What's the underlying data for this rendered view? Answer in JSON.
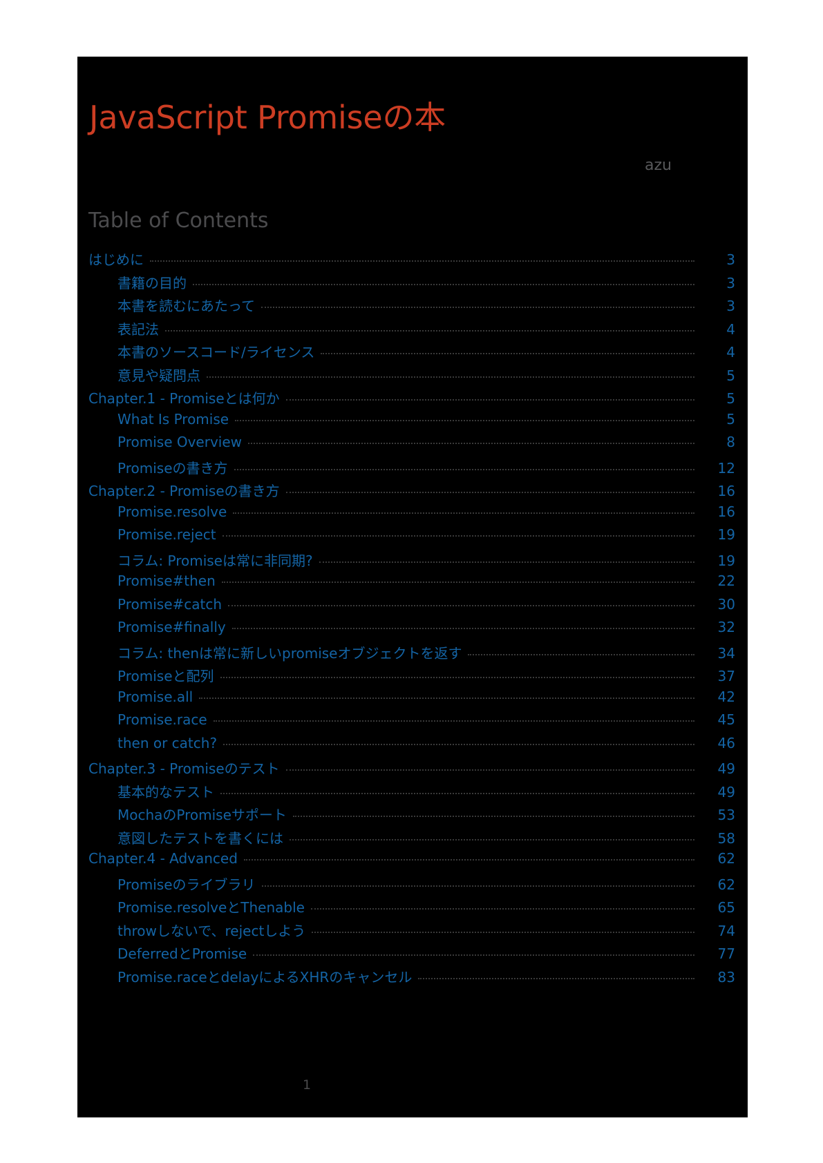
{
  "document": {
    "title": "JavaScript Promiseの本",
    "author": "azu",
    "toc_heading": "Table of Contents",
    "folio": "1",
    "colors": {
      "page_background": "#000000",
      "title": "#cc3d23",
      "heading": "#4b4b4d",
      "link": "#1464a5",
      "leader": "#3a3a3a"
    }
  },
  "toc": {
    "entries": [
      {
        "label": "はじめに",
        "page": "3",
        "level": 1
      },
      {
        "label": "書籍の目的",
        "page": "3",
        "level": 2
      },
      {
        "label": "本書を読むにあたって",
        "page": "3",
        "level": 2
      },
      {
        "label": "表記法",
        "page": "4",
        "level": 2
      },
      {
        "label": "本書のソースコード/ライセンス",
        "page": "4",
        "level": 2
      },
      {
        "label": "意見や疑問点",
        "page": "5",
        "level": 2
      },
      {
        "label": "Chapter.1 - Promiseとは何か",
        "page": "5",
        "level": 1
      },
      {
        "label": "What Is Promise",
        "page": "5",
        "level": 2
      },
      {
        "label": "Promise Overview",
        "page": "8",
        "level": 2
      },
      {
        "label": "Promiseの書き方",
        "page": "12",
        "level": 2
      },
      {
        "label": "Chapter.2 - Promiseの書き方",
        "page": "16",
        "level": 1
      },
      {
        "label": "Promise.resolve",
        "page": "16",
        "level": 2
      },
      {
        "label": "Promise.reject",
        "page": "19",
        "level": 2
      },
      {
        "label": "コラム: Promiseは常に非同期?",
        "page": "19",
        "level": 2
      },
      {
        "label": "Promise#then",
        "page": "22",
        "level": 2
      },
      {
        "label": "Promise#catch",
        "page": "30",
        "level": 2
      },
      {
        "label": "Promise#finally",
        "page": "32",
        "level": 2
      },
      {
        "label": "コラム: thenは常に新しいpromiseオブジェクトを返す",
        "page": "34",
        "level": 2
      },
      {
        "label": "Promiseと配列",
        "page": "37",
        "level": 2
      },
      {
        "label": "Promise.all",
        "page": "42",
        "level": 2
      },
      {
        "label": "Promise.race",
        "page": "45",
        "level": 2
      },
      {
        "label": "then or catch?",
        "page": "46",
        "level": 2
      },
      {
        "label": "Chapter.3 - Promiseのテスト",
        "page": "49",
        "level": 1
      },
      {
        "label": "基本的なテスト",
        "page": "49",
        "level": 2
      },
      {
        "label": "MochaのPromiseサポート",
        "page": "53",
        "level": 2
      },
      {
        "label": "意図したテストを書くには",
        "page": "58",
        "level": 2
      },
      {
        "label": "Chapter.4 - Advanced",
        "page": "62",
        "level": 1
      },
      {
        "label": "Promiseのライブラリ",
        "page": "62",
        "level": 2
      },
      {
        "label": "Promise.resolveとThenable",
        "page": "65",
        "level": 2
      },
      {
        "label": "throwしないで、rejectしよう",
        "page": "74",
        "level": 2
      },
      {
        "label": "DeferredとPromise",
        "page": "77",
        "level": 2
      },
      {
        "label": "Promise.raceとdelayによるXHRのキャンセル",
        "page": "83",
        "level": 2
      }
    ]
  }
}
